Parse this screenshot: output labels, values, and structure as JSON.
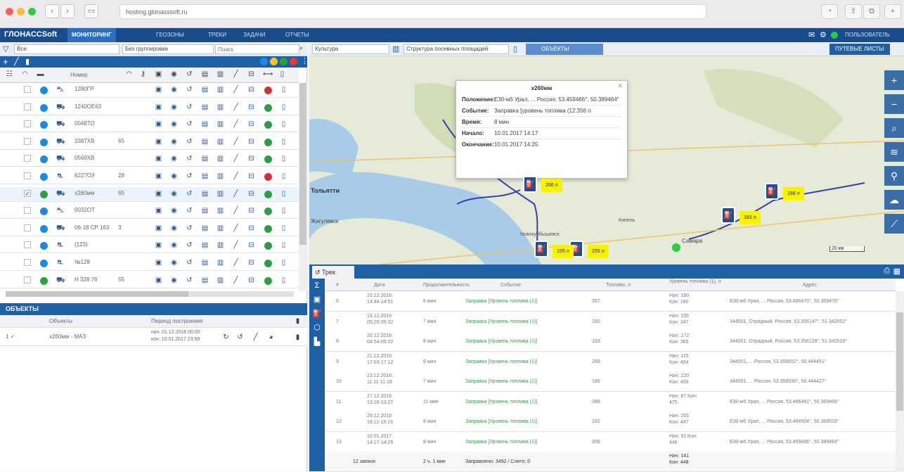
{
  "browser": {
    "url": "hosting.glonasssoft.ru",
    "colors": {
      "close": "#fc605c",
      "minimize": "#fdbc40",
      "zoom": "#34c84a"
    }
  },
  "app": {
    "logo": "ГЛОНАССSoft",
    "nav": [
      "МОНИТОРИНГ",
      "ГЕОЗОНЫ",
      "ТРЕКИ",
      "ЗАДАЧИ",
      "ОТЧЕТЫ"
    ],
    "user": "ПОЛЬЗОВАТЕЛЬ"
  },
  "left": {
    "filter": {
      "type": "Все",
      "group": "Без группировки",
      "search_placeholder": "Поиск"
    },
    "counters": [
      "0",
      "0",
      "0",
      "0"
    ],
    "column_name": "Номер",
    "vehicles": [
      {
        "name": "1280ГР",
        "num": "",
        "icon": "car-icon",
        "status": "#1e88e5",
        "last": "#d32f2f"
      },
      {
        "name": "1240ОЕ63",
        "num": "",
        "icon": "truck-icon",
        "status": "#1e88e5",
        "last": "#2e9e44"
      },
      {
        "name": "0048ТО",
        "num": "",
        "icon": "truck-icon",
        "status": "#1e88e5",
        "last": "#2e9e44"
      },
      {
        "name": "3387ХВ",
        "num": "65",
        "icon": "truck-icon",
        "status": "#1e88e5",
        "last": "#2e9e44"
      },
      {
        "name": "0560ХВ",
        "num": "",
        "icon": "truck-icon",
        "status": "#1e88e5",
        "last": "#2e9e44"
      },
      {
        "name": "6227ОУ",
        "num": "28",
        "icon": "bus-icon",
        "status": "#1e88e5",
        "last": "#d32f2f"
      },
      {
        "name": "х260мм",
        "num": "65",
        "icon": "truck-icon",
        "status": "#2e9e44",
        "last": "#2e9e44",
        "selected": true
      },
      {
        "name": "0032ОТ",
        "num": "",
        "icon": "car-icon",
        "status": "#1e88e5",
        "last": "#2e9e44"
      },
      {
        "name": "06-18 СР 163",
        "num": "3",
        "icon": "truck-icon",
        "status": "#1e88e5",
        "last": "#2e9e44"
      },
      {
        "name": "(123)",
        "num": "",
        "icon": "bus-icon",
        "status": "#1e88e5",
        "last": "#2e9e44"
      },
      {
        "name": "№128",
        "num": "",
        "icon": "bus-icon",
        "status": "#1e88e5",
        "last": "#2e9e44"
      },
      {
        "name": "Н 328 76",
        "num": "55",
        "icon": "truck-icon",
        "status": "#2e9e44",
        "last": "#2e9e44"
      }
    ]
  },
  "objects": {
    "title": "ОБЪЕКТЫ",
    "col_objects": "Объекты",
    "col_period": "Период построения",
    "row": {
      "name": "х260мм - МАЗ",
      "from": "нач: 01.12.2016 00:00",
      "to": "кон: 10.01.2017 23:59"
    }
  },
  "map": {
    "layer": "Культура",
    "structure": "Структура посевных площадей",
    "objects_btn": "ОБЪЕКТЫ",
    "waybills_btn": "ПУТЕВЫЕ ЛИСТЫ",
    "labels": [
      "Тольятти",
      "Жигулевск",
      "Самара",
      "Новокуйбышевск",
      "Кинель"
    ],
    "popup": {
      "title": "х260мм",
      "rows": [
        {
          "k": "Положение:",
          "v": "Е30-м5 Урал, ... Россия, 53.459466°, 50.389464°"
        },
        {
          "k": "Событие:",
          "v": "Заправка [уровень топлива (12.356 л"
        },
        {
          "k": "Время:",
          "v": "8 мин"
        },
        {
          "k": "Начало:",
          "v": "10.01.2017 14:17"
        },
        {
          "k": "Окончание:",
          "v": "10.01.2017 14:25"
        }
      ]
    },
    "markers": [
      {
        "n": "1",
        "v": "266 л"
      },
      {
        "n": "3",
        "v": "188 л"
      },
      {
        "n": "4",
        "v": "183 л"
      },
      {
        "n": "2",
        "v": "255 л"
      },
      {
        "n": "5",
        "v": "155 л"
      }
    ],
    "scale": "20 км"
  },
  "trips": {
    "tab": "Трек",
    "headers": [
      "#",
      "Дата",
      "Продолжительность",
      "Событие",
      "Топливо, л",
      "Уровень топлива (1), л",
      "Адрес"
    ],
    "rows": [
      {
        "n": "6",
        "date": "15.12.2016 14:44-14:51",
        "dur": "6 мин",
        "event": "Заправка [Уровень топлива (1)]",
        "fuel": "287",
        "lvl": "Нач: 160 Кон: 180",
        "addr": "Е30-м5 Урал, ... Россия, 53.466470°, 50.369476°"
      },
      {
        "n": "7",
        "date": "19.12.2016 05:25-05:32",
        "dur": "7 мин",
        "event": "Заправка [Уровень топлива (1)]",
        "fuel": "192",
        "lvl": "Нач: 155 Кон: 347",
        "addr": "344001, Отрадный, Россия, 53.356147°, 51.342552°"
      },
      {
        "n": "8",
        "date": "20.12.2016 04:54-05:02",
        "dur": "8 мин",
        "event": "Заправка [Уровень топлива (1)]",
        "fuel": "193",
        "lvl": "Нач: 172 Кон: 365",
        "addr": "344001, Отрадный, Россия, 53.356128°, 51.342519°"
      },
      {
        "n": "9",
        "date": "21.12.2016 17:03-17:12",
        "dur": "9 мин",
        "event": "Заправка [Уровень топлива (1)]",
        "fuel": "289",
        "lvl": "Нач: 115 Кон: 404",
        "addr": "344001, ... Россия, 53.358652°, 50.444451°"
      },
      {
        "n": "10",
        "date": "23.12.2016 11:11-11:18",
        "dur": "7 мин",
        "event": "Заправка [Уровень топлива (1)]",
        "fuel": "186",
        "lvl": "Нач: 220 Кон: 406",
        "addr": "344001, ... Россия, 53.358536°, 50.444427°"
      },
      {
        "n": "11",
        "date": "27.12.2016 13:16-13:27",
        "dur": "11 мин",
        "event": "Заправка [Уровень топлива (1)]",
        "fuel": "388",
        "lvl": "Нач: 87 Кон: 475",
        "addr": "Е30-м5 Урал, ... Россия, 53.466481°, 50.369469°"
      },
      {
        "n": "12",
        "date": "29.12.2016 18:11-18:19",
        "dur": "8 мин",
        "event": "Заправка [Уровень топлива (1)]",
        "fuel": "192",
        "lvl": "Нач: 255 Кон: 447",
        "addr": "Е30-м5 Урал, ... Россия, 53.466504°, 50.369518°"
      },
      {
        "n": "13",
        "date": "10.01.2017 14:17-14:25",
        "dur": "8 мин",
        "event": "Заправка [Уровень топлива (1)]",
        "fuel": "356",
        "lvl": "Нач: 91 Кон: 446",
        "addr": "Е30-м5 Урал, ... Россия, 53.459466°, 50.389464°"
      }
    ],
    "footer": {
      "count": "12 записи",
      "dur": "2 ч. 1 мин",
      "event": "Заправлено: 3492 / Слито: 0",
      "lvl": "Нач: 141 Кон: 448"
    }
  }
}
